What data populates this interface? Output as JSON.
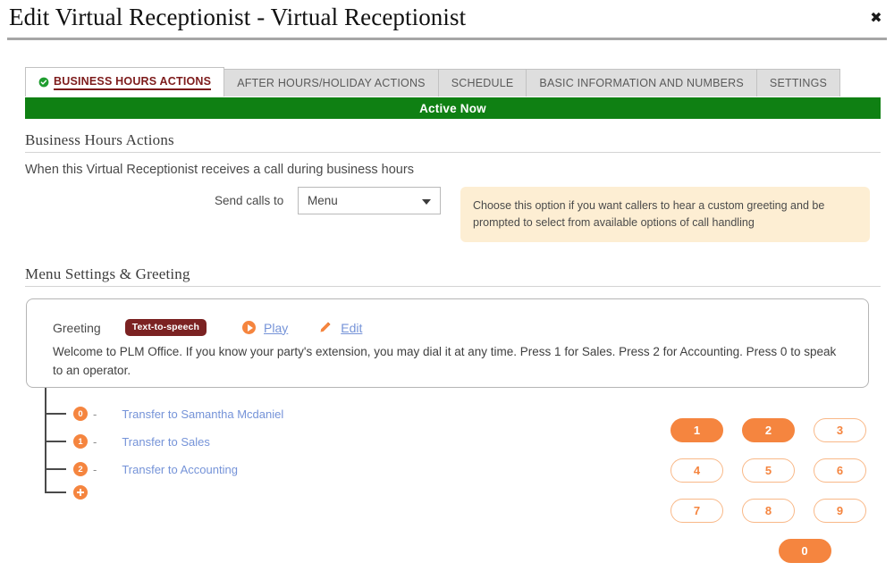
{
  "header": {
    "title": "Edit Virtual Receptionist - Virtual Receptionist",
    "close_label": "✖"
  },
  "tabs": [
    {
      "label": "BUSINESS HOURS ACTIONS",
      "active": true,
      "icon": "check-circle-icon"
    },
    {
      "label": "AFTER HOURS/HOLIDAY ACTIONS",
      "active": false
    },
    {
      "label": "SCHEDULE",
      "active": false
    },
    {
      "label": "BASIC INFORMATION AND NUMBERS",
      "active": false
    },
    {
      "label": "SETTINGS",
      "active": false
    }
  ],
  "status_bar": {
    "label": "Active Now",
    "color": "#0f8013"
  },
  "business_hours": {
    "heading": "Business Hours Actions",
    "description": "When this Virtual Receptionist receives a call during business hours",
    "send_calls_label": "Send calls to",
    "send_calls_value": "Menu",
    "send_calls_options": [
      "Menu"
    ],
    "tooltip": "Choose this option if you want callers to hear a custom greeting and be prompted to select from available options of call handling"
  },
  "menu_settings": {
    "heading": "Menu Settings & Greeting",
    "greeting_label": "Greeting",
    "greeting_type_badge": "Text-to-speech",
    "play_label": "Play",
    "edit_label": "Edit",
    "greeting_text": "Welcome to PLM Office. If you know your party's extension, you may dial it at any time. Press 1 for Sales. Press 2 for Accounting. Press 0 to speak to an operator."
  },
  "menu_tree": [
    {
      "digit": "0",
      "dash": "-",
      "action": "Transfer to Samantha Mcdaniel"
    },
    {
      "digit": "1",
      "dash": "-",
      "action": "Transfer to Sales"
    },
    {
      "digit": "2",
      "dash": "-",
      "action": "Transfer to Accounting"
    }
  ],
  "add_option_icon": "plus-circle-icon",
  "keypad": {
    "rows": [
      [
        {
          "key": "1",
          "assigned": true
        },
        {
          "key": "2",
          "assigned": true
        },
        {
          "key": "3",
          "assigned": false
        }
      ],
      [
        {
          "key": "4",
          "assigned": false
        },
        {
          "key": "5",
          "assigned": false
        },
        {
          "key": "6",
          "assigned": false
        }
      ],
      [
        {
          "key": "7",
          "assigned": false
        },
        {
          "key": "8",
          "assigned": false
        },
        {
          "key": "9",
          "assigned": false
        }
      ],
      [
        {
          "key": "0",
          "assigned": true
        }
      ]
    ]
  },
  "colors": {
    "accent_orange": "#f5853f",
    "active_green": "#0f8013",
    "badge_maroon": "#7b2222",
    "link_blue": "#7593d8",
    "tooltip_bg": "#fdeed3"
  }
}
